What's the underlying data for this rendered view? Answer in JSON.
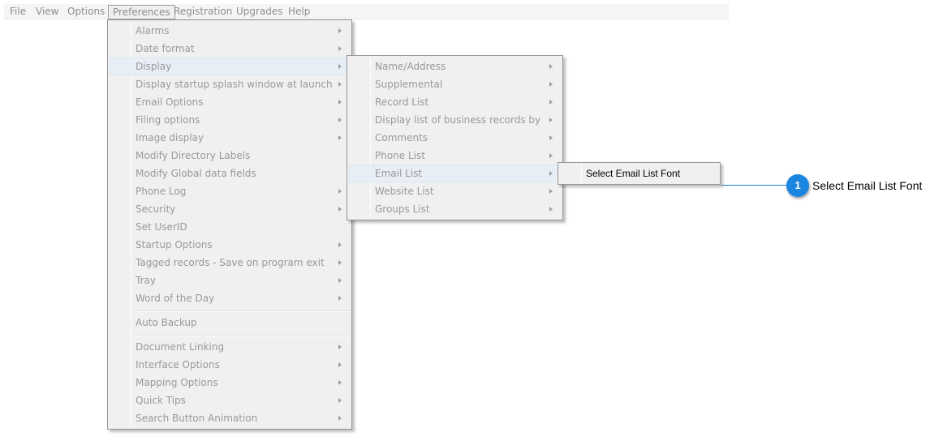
{
  "menubar": {
    "items": [
      "File",
      "View",
      "Options",
      "Preferences",
      "Registration",
      "Upgrades",
      "Help"
    ],
    "active": "Preferences"
  },
  "preferences_menu": {
    "items": [
      {
        "label": "Alarms",
        "submenu": true
      },
      {
        "label": "Date format",
        "submenu": true
      },
      {
        "label": "Display",
        "submenu": true,
        "highlighted": true
      },
      {
        "label": "Display startup splash window at launch",
        "submenu": true
      },
      {
        "label": "Email Options",
        "submenu": true
      },
      {
        "label": "Filing options",
        "submenu": true
      },
      {
        "label": "Image display",
        "submenu": true
      },
      {
        "label": "Modify Directory Labels",
        "submenu": false
      },
      {
        "label": "Modify Global data fields",
        "submenu": false
      },
      {
        "label": "Phone Log",
        "submenu": true
      },
      {
        "label": "Security",
        "submenu": true
      },
      {
        "label": "Set UserID",
        "submenu": false
      },
      {
        "label": "Startup Options",
        "submenu": true
      },
      {
        "label": "Tagged records - Save on program exit",
        "submenu": true
      },
      {
        "label": "Tray",
        "submenu": true
      },
      {
        "label": "Word of the Day",
        "submenu": true
      },
      {
        "label": "Auto Backup",
        "submenu": false
      },
      {
        "label": "Document Linking",
        "submenu": true
      },
      {
        "label": "Interface Options",
        "submenu": true
      },
      {
        "label": "Mapping Options",
        "submenu": true
      },
      {
        "label": "Quick Tips",
        "submenu": true
      },
      {
        "label": "Search Button Animation",
        "submenu": true
      }
    ]
  },
  "display_submenu": {
    "items": [
      {
        "label": "Name/Address",
        "submenu": true
      },
      {
        "label": "Supplemental",
        "submenu": true
      },
      {
        "label": "Record List",
        "submenu": true
      },
      {
        "label": "Display list of business records by",
        "submenu": true
      },
      {
        "label": "Comments",
        "submenu": true
      },
      {
        "label": "Phone List",
        "submenu": true
      },
      {
        "label": "Email List",
        "submenu": true,
        "highlighted": true
      },
      {
        "label": "Website List",
        "submenu": true
      },
      {
        "label": "Groups List",
        "submenu": true
      }
    ]
  },
  "email_list_submenu": {
    "item": "Select Email List Font"
  },
  "callout": {
    "number": "1",
    "text": "Select Email List Font",
    "color": "#1a86e0"
  }
}
